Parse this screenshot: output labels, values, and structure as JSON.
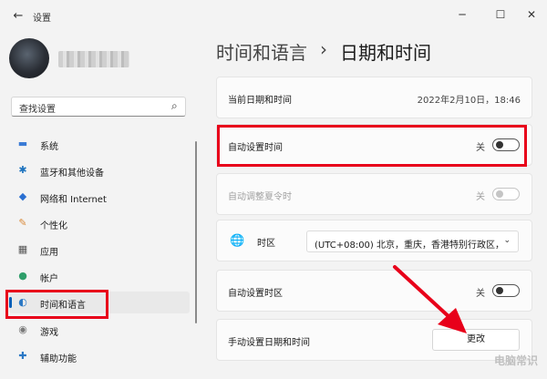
{
  "window": {
    "back_icon": "←",
    "title": "设置",
    "minimize_icon": "─",
    "maximize_icon": "☐",
    "close_icon": "✕"
  },
  "search": {
    "placeholder": "查找设置",
    "icon": "⌕"
  },
  "sidebar": {
    "items": [
      {
        "label": "系统",
        "icon": "▬",
        "color": "#3a7bd5"
      },
      {
        "label": "蓝牙和其他设备",
        "icon": "✱",
        "color": "#1e73be"
      },
      {
        "label": "网络和 Internet",
        "icon": "◆",
        "color": "#2a6fd1"
      },
      {
        "label": "个性化",
        "icon": "✎",
        "color": "#d98a3a"
      },
      {
        "label": "应用",
        "icon": "▦",
        "color": "#555555"
      },
      {
        "label": "帐户",
        "icon": "●",
        "color": "#2e9e6a"
      },
      {
        "label": "时间和语言",
        "icon": "◐",
        "color": "#2b78c5"
      },
      {
        "label": "游戏",
        "icon": "◉",
        "color": "#7a7a7a"
      },
      {
        "label": "辅助功能",
        "icon": "✚",
        "color": "#2b78c5"
      }
    ]
  },
  "breadcrumb": {
    "parent": "时间和语言",
    "separator": "›",
    "current": "日期和时间"
  },
  "main": {
    "current_datetime_label": "当前日期和时间",
    "current_datetime_value": "2022年2月10日，18:46",
    "auto_time_label": "自动设置时间",
    "auto_time_state": "关",
    "dst_label": "自动调整夏令时",
    "dst_state": "关",
    "timezone_label": "时区",
    "timezone_icon": "🌐",
    "timezone_value": "(UTC+08:00) 北京，重庆，香港特别行政区，",
    "timezone_chevron": "⌄",
    "auto_timezone_label": "自动设置时区",
    "auto_timezone_state": "关",
    "manual_label": "手动设置日期和时间",
    "change_button": "更改"
  },
  "watermark": "电脑常识",
  "colors": {
    "highlight": "#e8001a",
    "accent": "#005fb8"
  }
}
